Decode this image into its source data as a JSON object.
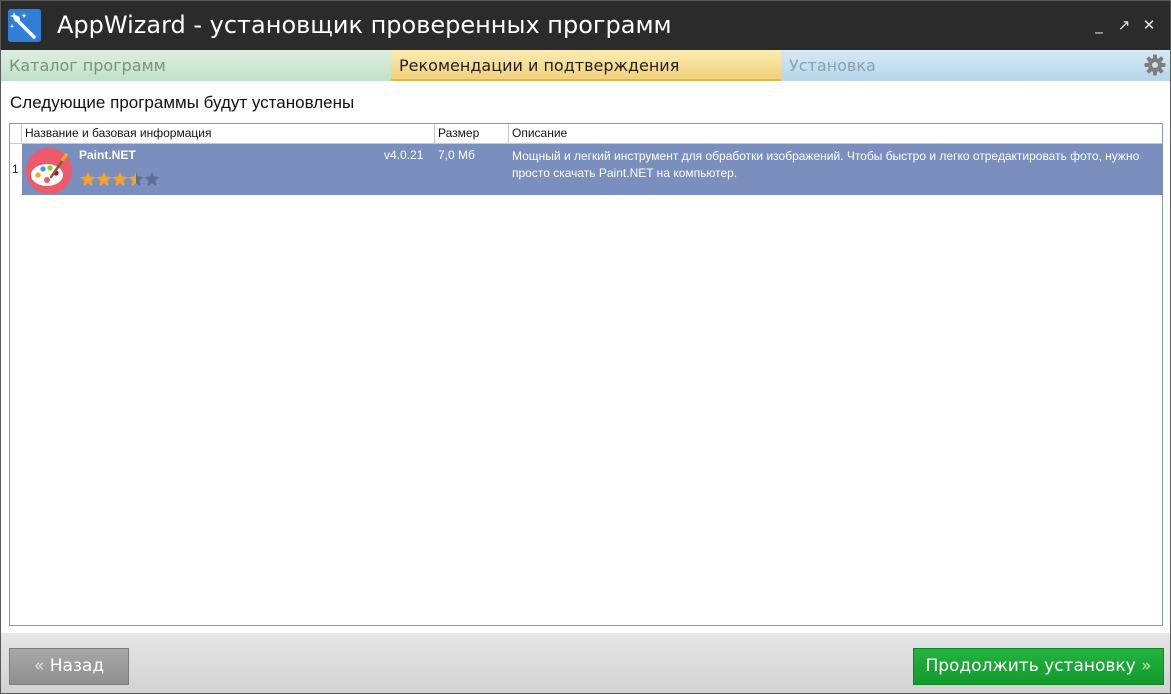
{
  "window": {
    "title": "AppWizard - установщик проверенных программ",
    "controls": {
      "minimize": "_",
      "maximize": "↗",
      "close": "✕"
    }
  },
  "steps": [
    {
      "label": "Каталог программ",
      "state": "done"
    },
    {
      "label": "Рекомендации и подтверждения",
      "state": "active"
    },
    {
      "label": "Установка",
      "state": "pending"
    }
  ],
  "settings_icon": "gear-icon",
  "content": {
    "heading": "Следующие программы будут установлены",
    "columns": {
      "name": "Название и базовая информация",
      "size": "Размер",
      "description": "Описание"
    },
    "rows": [
      {
        "index": "1",
        "name": "Paint.NET",
        "version": "v4.0.21",
        "size": "7,0 Мб",
        "rating": 3.5,
        "rating_max": 5,
        "icon": "palette-icon",
        "description": "Мощный и легкий инструмент для обработки изображений. Чтобы быстро и легко отредактировать фото, нужно просто скачать Paint.NET на компьютер."
      }
    ]
  },
  "footer": {
    "back_label": "Назад",
    "back_chevron": "«",
    "next_label": "Продолжить установку",
    "next_chevron": "»"
  },
  "colors": {
    "selected_row": "#7a8fbd",
    "next_button": "#1aa636",
    "back_button": "#9c9c9c",
    "star_filled": "#f5a623",
    "star_empty": "#5f6f93"
  }
}
